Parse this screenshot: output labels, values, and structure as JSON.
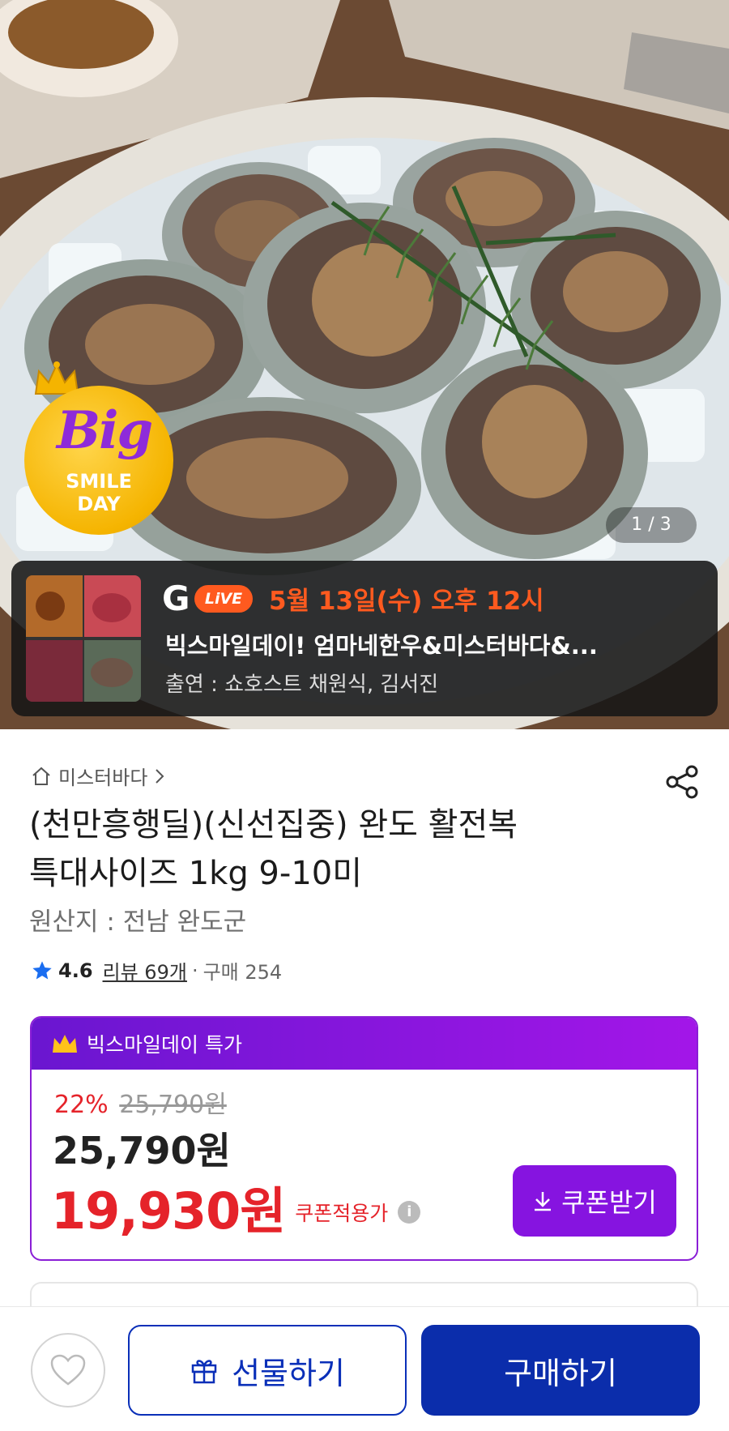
{
  "hero": {
    "badge": {
      "big": "Big",
      "smile": "SMILE",
      "day": "DAY"
    },
    "page_indicator": "1 / 3"
  },
  "live": {
    "brand_g": "G",
    "live_label": "LiVE",
    "schedule": "5월 13일(수) 오후 12시",
    "title": "빅스마일데이! 엄마네한우&미스터바다&...",
    "cast": "출연 : 쇼호스트 채원식, 김서진"
  },
  "product": {
    "shop": "미스터바다",
    "title_line1": "(천만흥행딜)(신선집중) 완도 활전복",
    "title_line2": "특대사이즈 1kg 9-10미",
    "origin": "원산지 : 전남 완도군",
    "rating": "4.6",
    "reviews": "리뷰 69개",
    "purchases": "구매 254"
  },
  "price_box": {
    "header": "빅스마일데이 특가",
    "discount_pct": "22%",
    "original_price": "25,790원",
    "price": "25,790원",
    "coupon_price": "19,930원",
    "coupon_label": "쿠폰적용가",
    "coupon_button": "쿠폰받기"
  },
  "bottom_bar": {
    "gift": "선물하기",
    "buy": "구매하기"
  },
  "colors": {
    "accent_purple": "#8614e0",
    "sale_red": "#e5232a",
    "buy_blue": "#0b2dab",
    "live_orange": "#ff5a1f"
  },
  "icons": [
    "home-icon",
    "chevron-right-icon",
    "share-icon",
    "star-icon",
    "crown-icon",
    "info-icon",
    "download-icon",
    "heart-icon",
    "gift-icon"
  ]
}
